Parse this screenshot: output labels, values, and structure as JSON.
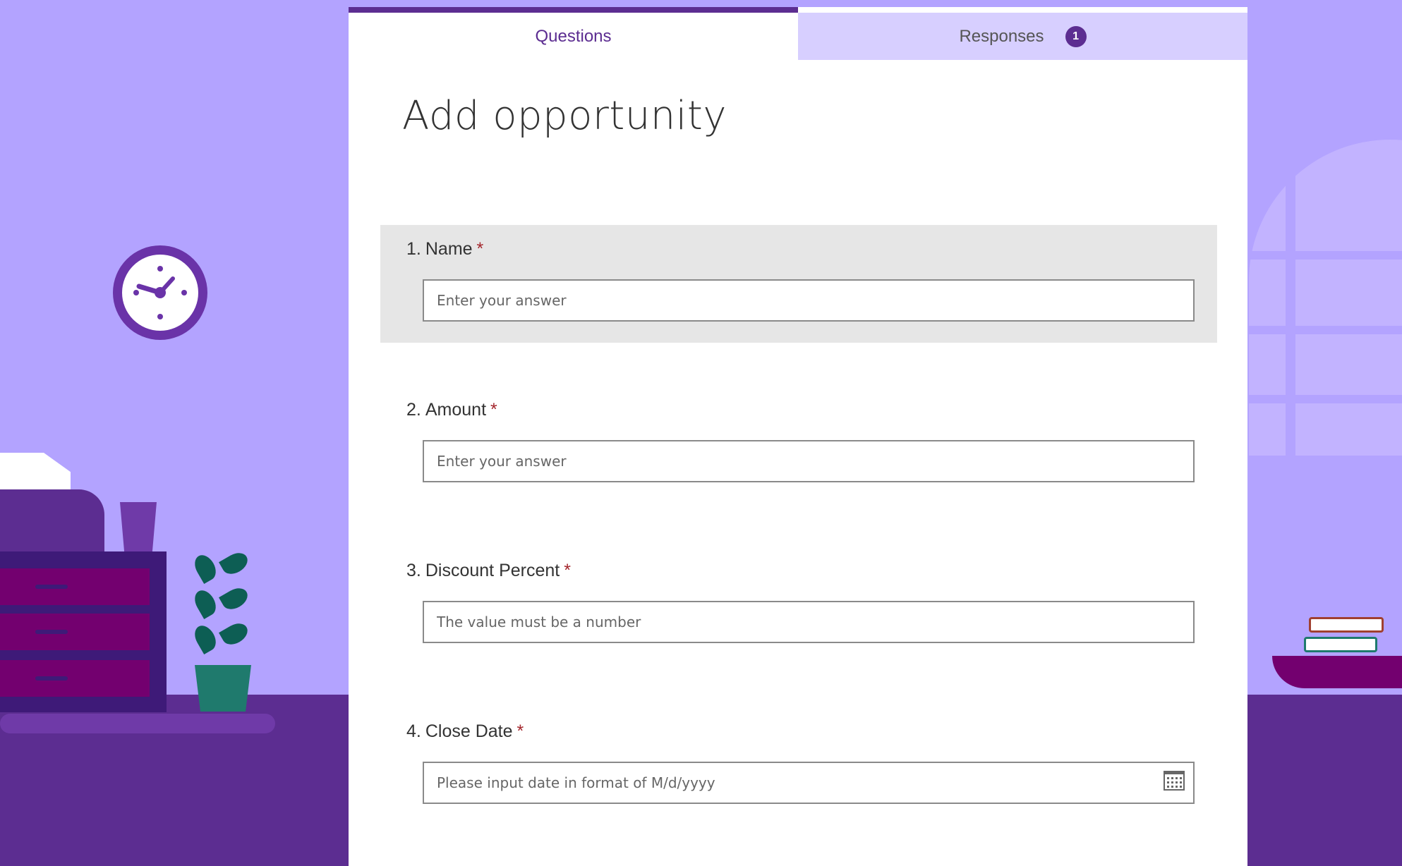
{
  "tabs": {
    "questions_label": "Questions",
    "responses_label": "Responses",
    "responses_count": "1"
  },
  "form": {
    "title": "Add opportunity"
  },
  "questions": [
    {
      "number": "1.",
      "label": "Name",
      "required": "*",
      "placeholder": "Enter your answer"
    },
    {
      "number": "2.",
      "label": "Amount",
      "required": "*",
      "placeholder": "Enter your answer"
    },
    {
      "number": "3.",
      "label": "Discount Percent",
      "required": "*",
      "placeholder": "The value must be a number"
    },
    {
      "number": "4.",
      "label": "Close Date",
      "required": "*",
      "placeholder": "Please input date in format of M/d/yyyy"
    }
  ],
  "colors": {
    "accent": "#5c2d91",
    "background": "#b3a3ff",
    "required": "#a4262c",
    "highlight": "#e6e6e6"
  },
  "icons": {
    "date_picker": "calendar-icon"
  }
}
